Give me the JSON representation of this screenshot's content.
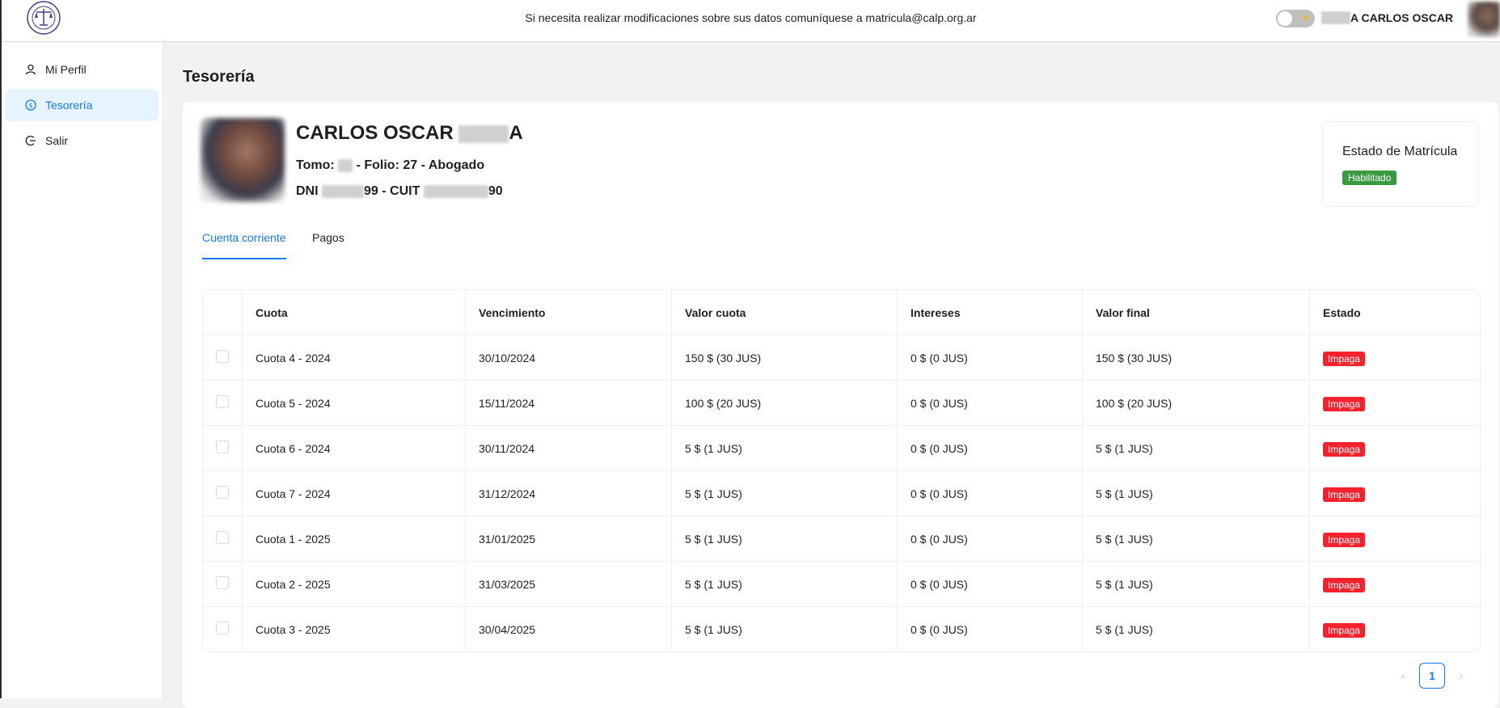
{
  "header": {
    "notice": "Si necesita realizar modificaciones sobre sus datos comuníquese a matricula@calp.org.ar",
    "user_name": "A CARLOS OSCAR",
    "theme_icon": "sun-icon"
  },
  "sidebar": {
    "items": [
      {
        "label": "Mi Perfil",
        "icon": "user-icon"
      },
      {
        "label": "Tesorería",
        "icon": "dollar-circle-icon"
      },
      {
        "label": "Salir",
        "icon": "logout-icon"
      }
    ]
  },
  "page": {
    "title": "Tesorería"
  },
  "profile": {
    "name": "CARLOS OSCAR",
    "name_suffix": "A",
    "tomo_label": "Tomo:",
    "folio_text": "- Folio: 27 - Abogado",
    "dni_label": "DNI",
    "dni_tail": "99",
    "cuit_label": "- CUIT",
    "cuit_tail": "90"
  },
  "estado": {
    "title": "Estado de Matrícula",
    "status": "Habilitado",
    "status_color": "#3a9a3f"
  },
  "tabs": [
    {
      "label": "Cuenta corriente",
      "active": true
    },
    {
      "label": "Pagos",
      "active": false
    }
  ],
  "table": {
    "headers": [
      "Cuota",
      "Vencimiento",
      "Valor cuota",
      "Intereses",
      "Valor final",
      "Estado"
    ],
    "rows": [
      [
        "Cuota 4 - 2024",
        "30/10/2024",
        "150 $ (30 JUS)",
        "0 $ (0 JUS)",
        "150 $ (30 JUS)",
        "Impaga"
      ],
      [
        "Cuota 5 - 2024",
        "15/11/2024",
        "100 $ (20 JUS)",
        "0 $ (0 JUS)",
        "100 $ (20 JUS)",
        "Impaga"
      ],
      [
        "Cuota 6 - 2024",
        "30/11/2024",
        "5 $ (1 JUS)",
        "0 $ (0 JUS)",
        "5 $ (1 JUS)",
        "Impaga"
      ],
      [
        "Cuota 7 - 2024",
        "31/12/2024",
        "5 $ (1 JUS)",
        "0 $ (0 JUS)",
        "5 $ (1 JUS)",
        "Impaga"
      ],
      [
        "Cuota 1 - 2025",
        "31/01/2025",
        "5 $ (1 JUS)",
        "0 $ (0 JUS)",
        "5 $ (1 JUS)",
        "Impaga"
      ],
      [
        "Cuota 2 - 2025",
        "31/03/2025",
        "5 $ (1 JUS)",
        "0 $ (0 JUS)",
        "5 $ (1 JUS)",
        "Impaga"
      ],
      [
        "Cuota 3 - 2025",
        "30/04/2025",
        "5 $ (1 JUS)",
        "0 $ (0 JUS)",
        "5 $ (1 JUS)",
        "Impaga"
      ]
    ],
    "status_color": "#f5222d"
  },
  "pagination": {
    "current": "1",
    "prev_icon": "chevron-left-icon",
    "next_icon": "chevron-right-icon"
  }
}
